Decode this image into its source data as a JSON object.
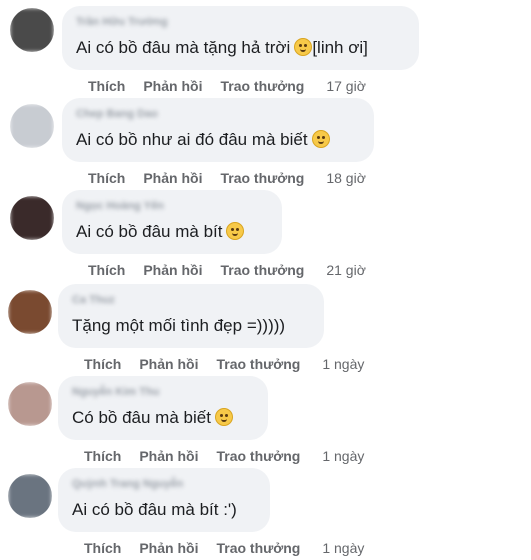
{
  "comments": [
    {
      "author": "Trần Hữu Trường",
      "text": "Ai có bồ đâu mà tặng hả trời",
      "emoji_after": "laughing-tears-emoji",
      "suffix": "[linh ơi]",
      "like": "Thích",
      "reply": "Phản hồi",
      "reward": "Trao thưởng",
      "time": "17 giờ",
      "avatar_color": "#4a4a4a"
    },
    {
      "author": "Chep Bang Dao",
      "text": "Ai có bồ như ai đó đâu mà biết",
      "emoji_after": "rolling-eyes-emoji",
      "like": "Thích",
      "reply": "Phản hồi",
      "reward": "Trao thưởng",
      "time": "18 giờ",
      "avatar_color": "#c8ccd2"
    },
    {
      "author": "Ngọc Hoàng Yến",
      "text": "Ai có bồ đâu mà bít",
      "emoji_after": "crying-emoji",
      "like": "Thích",
      "reply": "Phản hồi",
      "reward": "Trao thưởng",
      "time": "21 giờ",
      "avatar_color": "#3a2a2a"
    },
    {
      "author": "Ca Thuz",
      "text": "Tặng một mối tình đẹp =)))))",
      "like": "Thích",
      "reply": "Phản hồi",
      "reward": "Trao thưởng",
      "time": "1 ngày",
      "avatar_color": "#7a4a30"
    },
    {
      "author": "Nguyễn Kim Thu",
      "text": "Có bồ đâu mà biết",
      "emoji_after": "sad-emoji",
      "like": "Thích",
      "reply": "Phản hồi",
      "reward": "Trao thưởng",
      "time": "1 ngày",
      "avatar_color": "#b89890"
    },
    {
      "author": "Quỳnh Trang Nguyễn",
      "text": "Ai có bồ đâu mà bít :')",
      "like": "Thích",
      "reply": "Phản hồi",
      "reward": "Trao thưởng",
      "time": "1 ngày",
      "avatar_color": "#6a7480"
    }
  ]
}
